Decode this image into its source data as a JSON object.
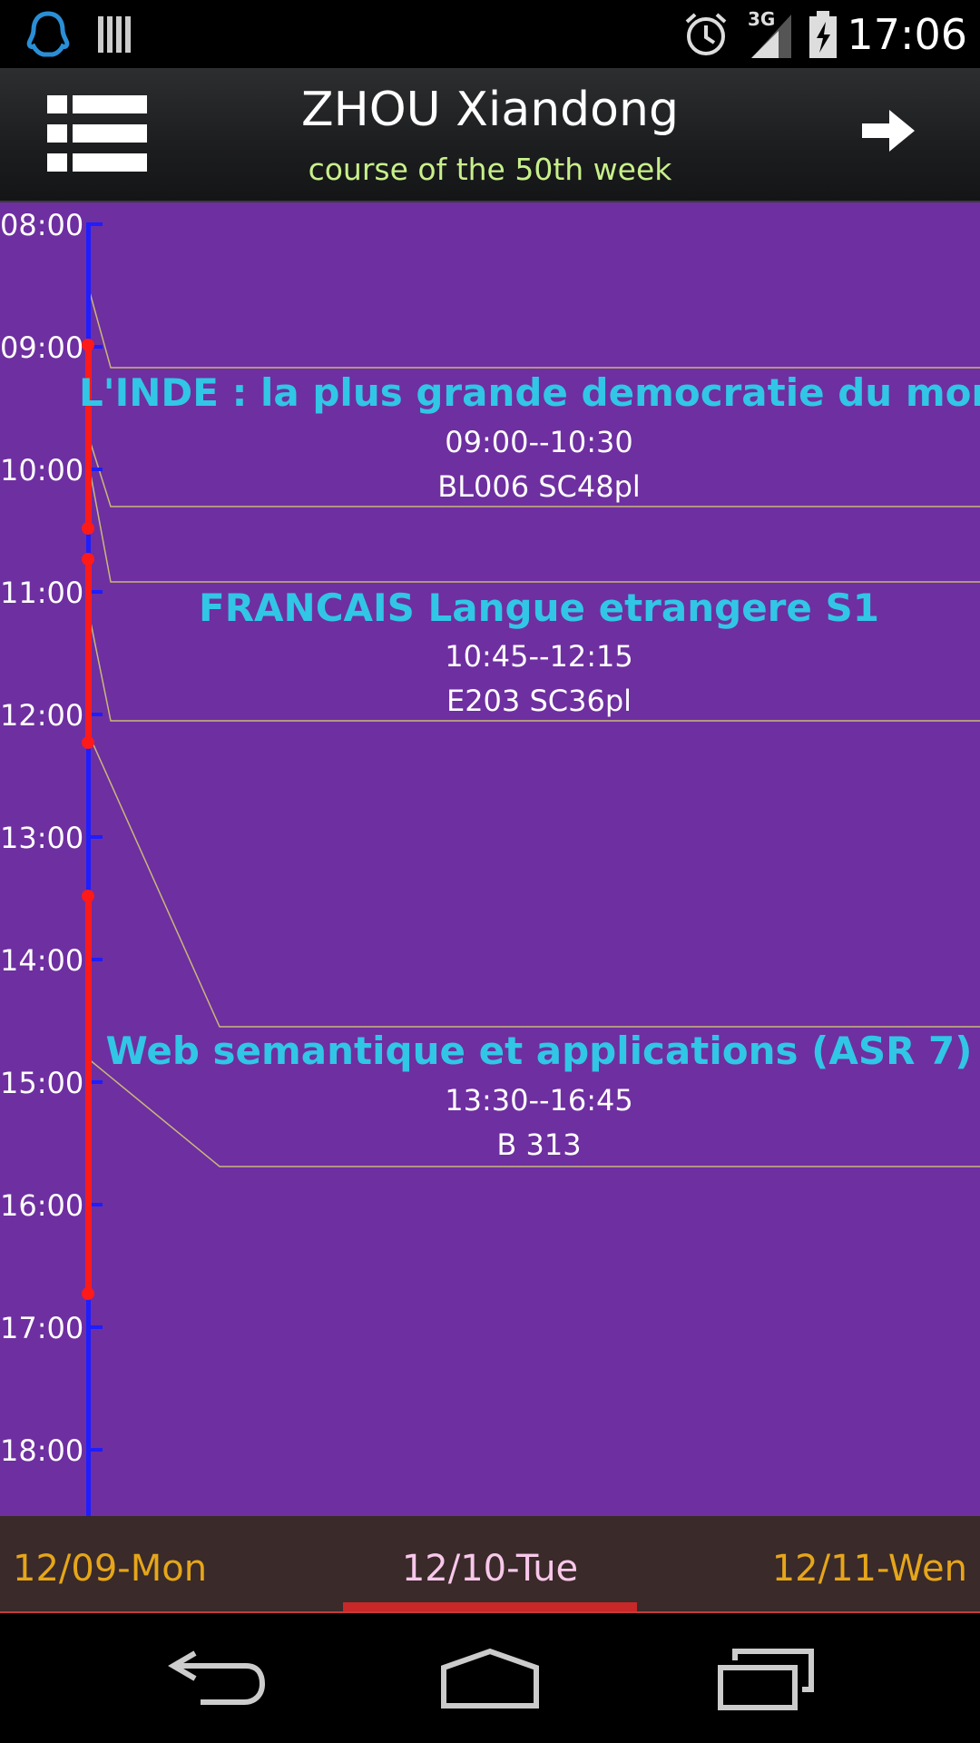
{
  "status_bar": {
    "time": "17:06",
    "network": "3G",
    "icons": [
      "qq-penguin-icon",
      "storage-bars-icon",
      "alarm-icon",
      "signal-icon",
      "battery-charging-icon"
    ]
  },
  "app_bar": {
    "title": "ZHOU Xiandong",
    "subtitle": "course of the 50th week",
    "menu_icon": "list-icon",
    "next_icon": "arrow-right-icon"
  },
  "timeline": {
    "hours": [
      "08:00",
      "09:00",
      "10:00",
      "11:00",
      "12:00",
      "13:00",
      "14:00",
      "15:00",
      "16:00",
      "17:00",
      "18:00"
    ],
    "courses": [
      {
        "title": "L'INDE : la plus grande democratie du monde ?",
        "time": "09:00--10:30",
        "room": "BL006 SC48pl"
      },
      {
        "title": "FRANCAIS Langue etrangere S1",
        "time": "10:45--12:15",
        "room": "E203 SC36pl"
      },
      {
        "title": "Web semantique et applications (ASR 7)",
        "time": "13:30--16:45",
        "room": "B 313"
      }
    ],
    "colors": {
      "background": "#6e2fa0",
      "axis": "#1e1eff",
      "course_bar": "#ff1a1a",
      "course_title": "#31c6e6"
    }
  },
  "day_tabs": {
    "prev": "12/09-Mon",
    "current": "12/10-Tue",
    "next": "12/11-Wen"
  },
  "nav_bar": {
    "icons": [
      "back-icon",
      "home-icon",
      "recents-icon"
    ]
  }
}
